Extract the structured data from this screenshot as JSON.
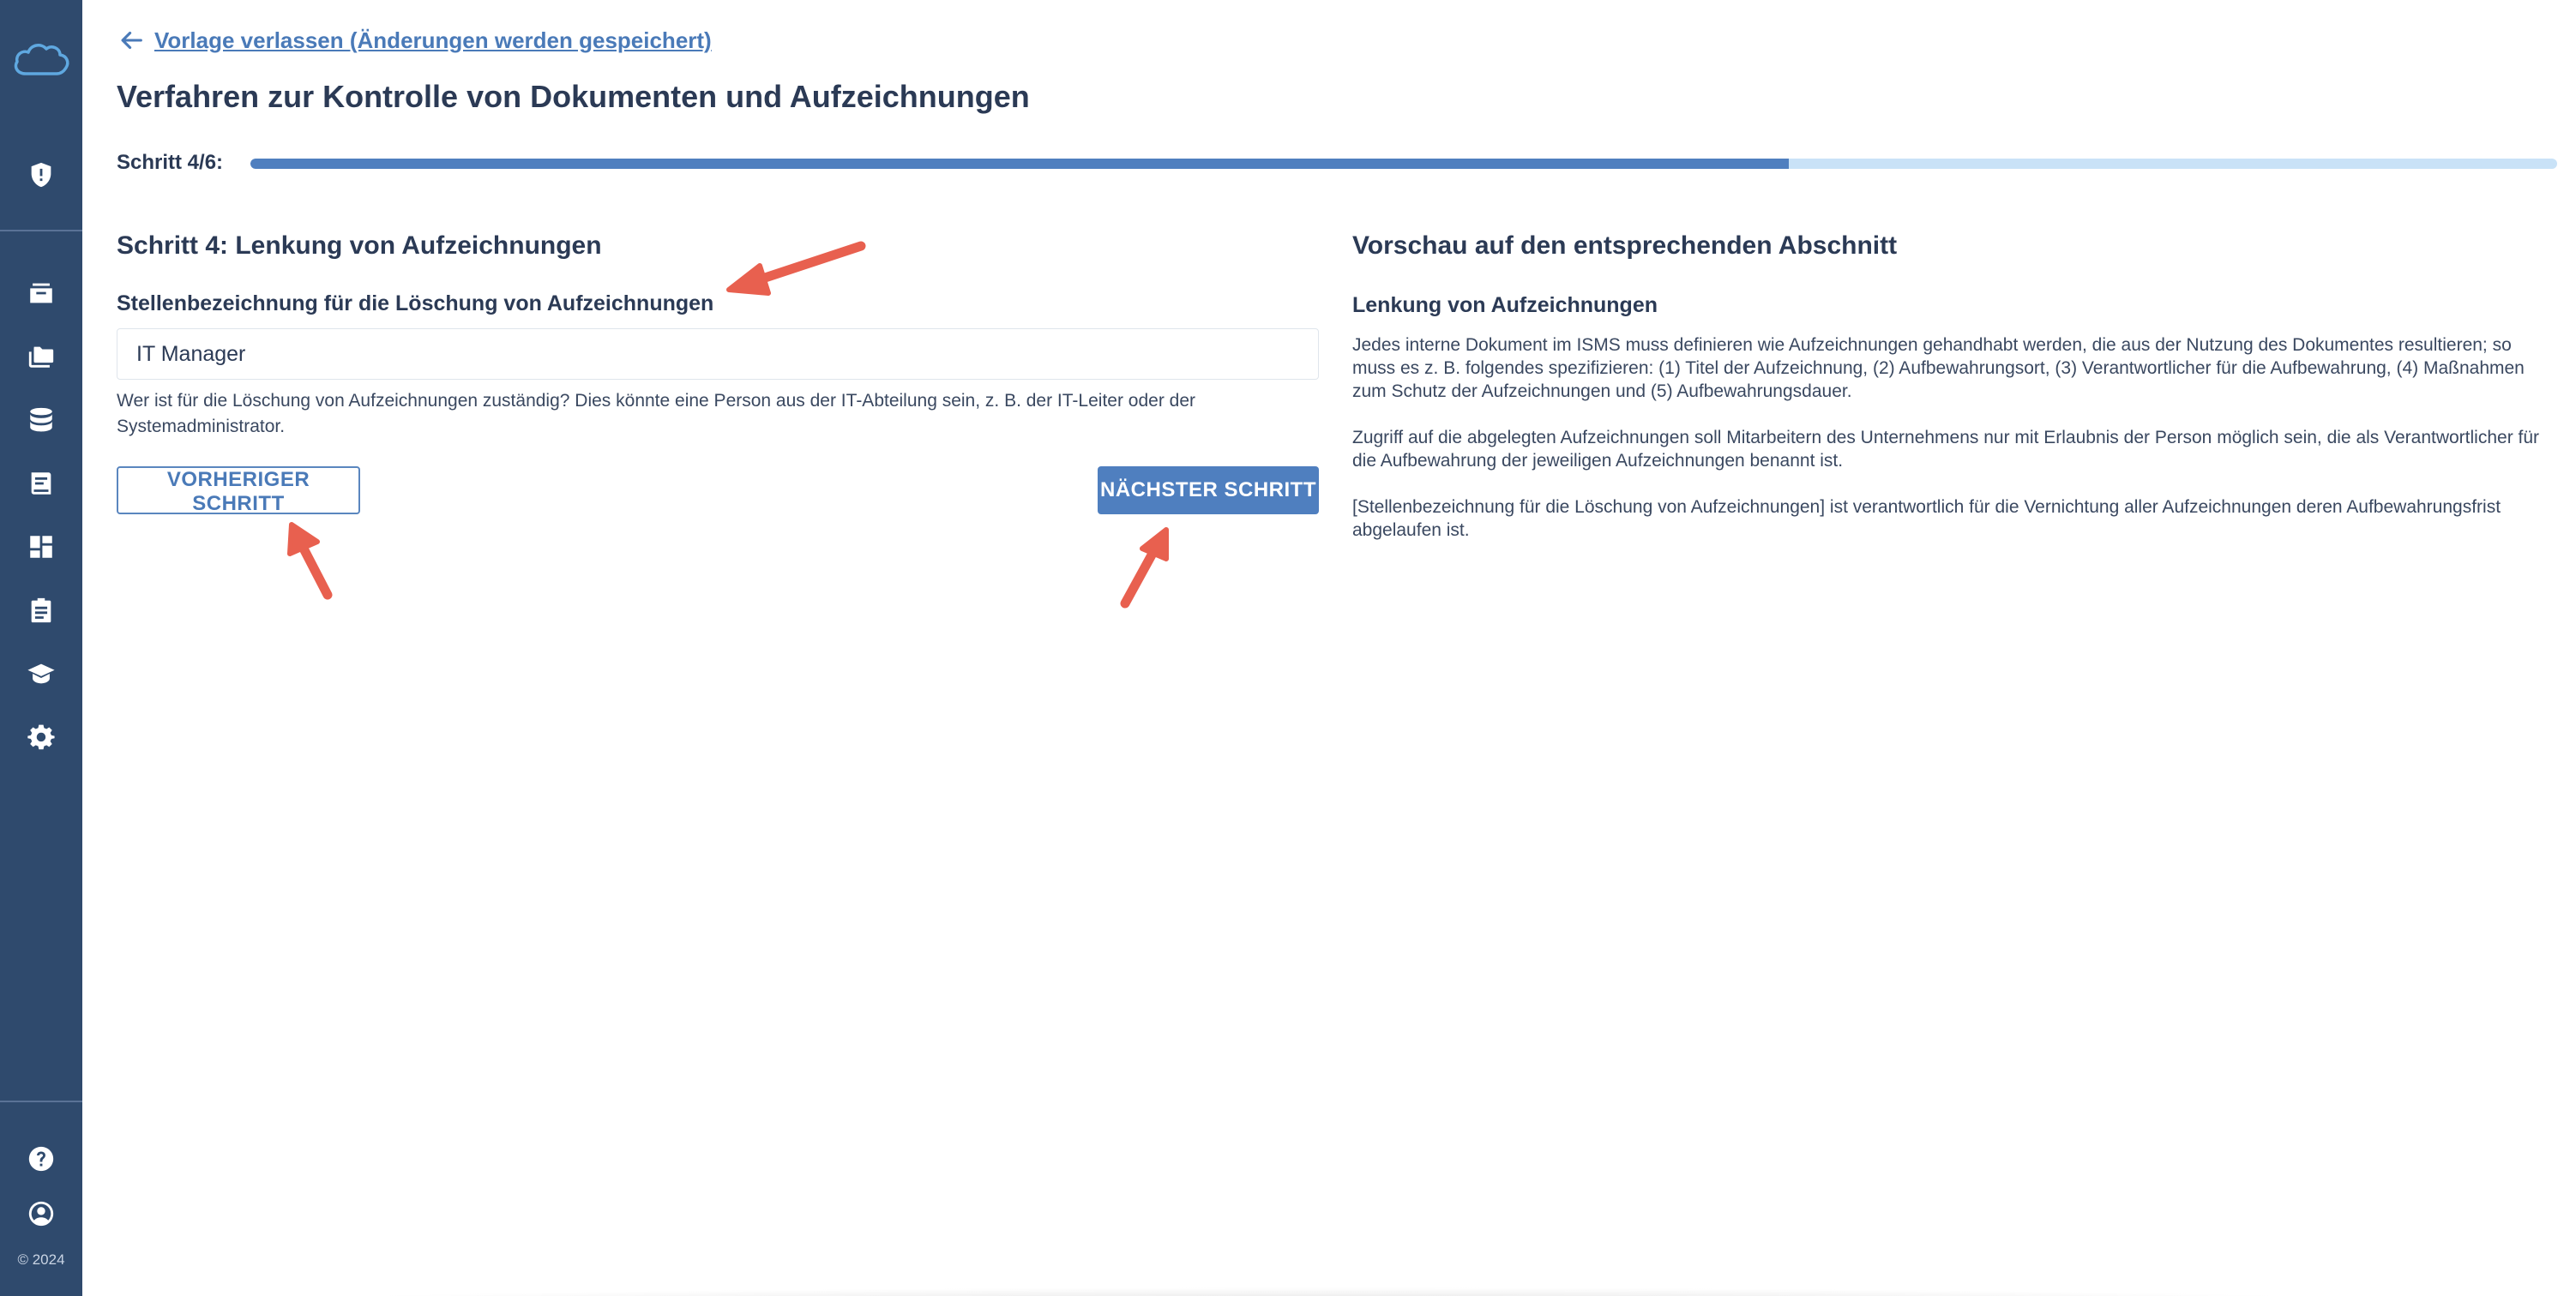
{
  "sidebar": {
    "copyright": "© 2024",
    "icons": [
      "cloud-logo-icon",
      "shield-icon",
      "archive-icon",
      "folder-icon",
      "database-icon",
      "book-icon",
      "dashboard-icon",
      "clipboard-icon",
      "graduation-cap-icon",
      "gear-icon",
      "help-icon",
      "account-icon"
    ]
  },
  "header": {
    "back_link": "Vorlage verlassen (Änderungen werden gespeichert)",
    "title": "Verfahren zur Kontrolle von Dokumenten und Aufzeichnungen",
    "step_label": "Schritt 4/6:",
    "progress_fraction": 0.667
  },
  "form": {
    "heading": "Schritt 4: Lenkung von Aufzeichnungen",
    "field_label": "Stellenbezeichnung für die Löschung von Aufzeichnungen",
    "field_value": "IT Manager",
    "help_text": "Wer ist für die Löschung von Aufzeichnungen zuständig? Dies könnte eine Person aus der IT-Abteilung sein, z. B. der IT-Leiter oder der Systemadministrator.",
    "prev_button": "VORHERIGER SCHRITT",
    "next_button": "NÄCHSTER SCHRITT"
  },
  "preview": {
    "heading": "Vorschau auf den entsprechenden Abschnitt",
    "subheading": "Lenkung von Aufzeichnungen",
    "paragraphs": [
      "Jedes interne Dokument im ISMS muss definieren wie Aufzeichnungen gehandhabt werden, die aus der Nutzung des Dokumentes resultieren; so muss es z. B. folgendes spezifizieren: (1) Titel der Aufzeichnung, (2) Aufbewahrungsort, (3) Verantwortlicher für die Aufbewahrung, (4) Maßnahmen zum Schutz der Aufzeichnungen und (5) Aufbewahrungsdauer.",
      "Zugriff auf die abgelegten Aufzeichnungen soll Mitarbeitern des Unternehmens nur mit Erlaubnis der Person möglich sein, die als Verantwortlicher für die Aufbewahrung der jeweiligen Aufzeichnungen benannt ist.",
      "[Stellenbezeichnung für die Löschung von Aufzeichnungen] ist verantwortlich für die Vernichtung aller Aufzeichnungen deren Aufbewahrungsfrist abgelaufen ist."
    ]
  },
  "colors": {
    "sidebar": "#2f4a6d",
    "accent": "#4f7fbf",
    "progress_track": "#c9e2f7",
    "annotation_arrow": "#e8604f"
  }
}
